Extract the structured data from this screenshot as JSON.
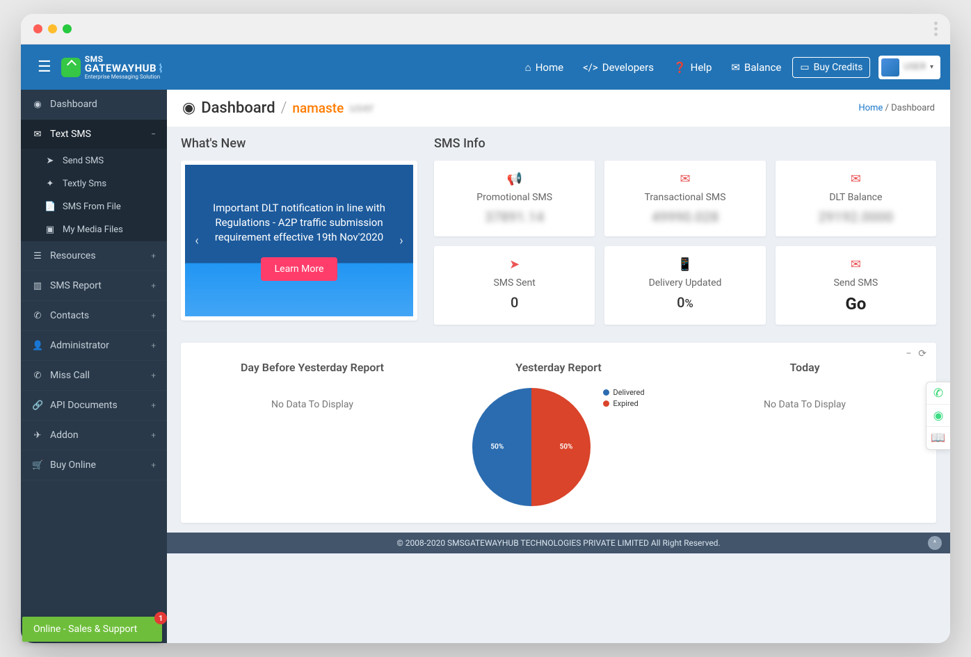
{
  "logo": {
    "line1": "SMS",
    "line2": "GATEWAYHUB",
    "tag": "Enterprise Messaging Solution"
  },
  "topnav": {
    "home": "Home",
    "developers": "Developers",
    "help": "Help",
    "balance": "Balance",
    "buy_credits": "Buy Credits",
    "user": "USER"
  },
  "sidebar": {
    "dashboard": "Dashboard",
    "text_sms": "Text SMS",
    "sub": {
      "send": "Send SMS",
      "textly": "Textly Sms",
      "fromfile": "SMS From File",
      "media": "My Media Files"
    },
    "resources": "Resources",
    "sms_report": "SMS Report",
    "contacts": "Contacts",
    "administrator": "Administrator",
    "miss_call": "Miss Call",
    "api_docs": "API Documents",
    "addon": "Addon",
    "buy_online": "Buy Online"
  },
  "page": {
    "title": "Dashboard",
    "greet": "namaste",
    "greet_sub": "user",
    "crumb_home": "Home",
    "crumb_cur": "Dashboard"
  },
  "sections": {
    "whats_new": "What's New",
    "sms_info": "SMS Info"
  },
  "carousel": {
    "text": "Important DLT notification in line with Regulations - A2P traffic submission requirement effective 19th Nov'2020",
    "learn": "Learn More"
  },
  "cards": {
    "promo": {
      "t": "Promotional SMS",
      "v": "37891.14"
    },
    "trans": {
      "t": "Transactional SMS",
      "v": "49990.028"
    },
    "dlt": {
      "t": "DLT Balance",
      "v": "29192.0000"
    },
    "sent": {
      "t": "SMS Sent",
      "v": "0"
    },
    "delivery": {
      "t": "Delivery Updated",
      "v": "0",
      "suffix": "%"
    },
    "send": {
      "t": "Send SMS",
      "v": "Go"
    }
  },
  "reports": {
    "c1": "Day Before Yesterday Report",
    "c2": "Yesterday Report",
    "c3": "Today",
    "nodata": "No Data To Display",
    "legend": {
      "delivered": "Delivered",
      "expired": "Expired"
    }
  },
  "chart_data": {
    "type": "pie",
    "title": "Yesterday Report",
    "series": [
      {
        "name": "Delivered",
        "value": 50,
        "color": "#2b6cb0"
      },
      {
        "name": "Expired",
        "value": 50,
        "color": "#d9442a"
      }
    ]
  },
  "footer": "© 2008-2020 SMSGATEWAYHUB TECHNOLOGIES PRIVATE LIMITED All Right Reserved.",
  "chat": {
    "label": "Online - Sales & Support",
    "badge": "1"
  }
}
